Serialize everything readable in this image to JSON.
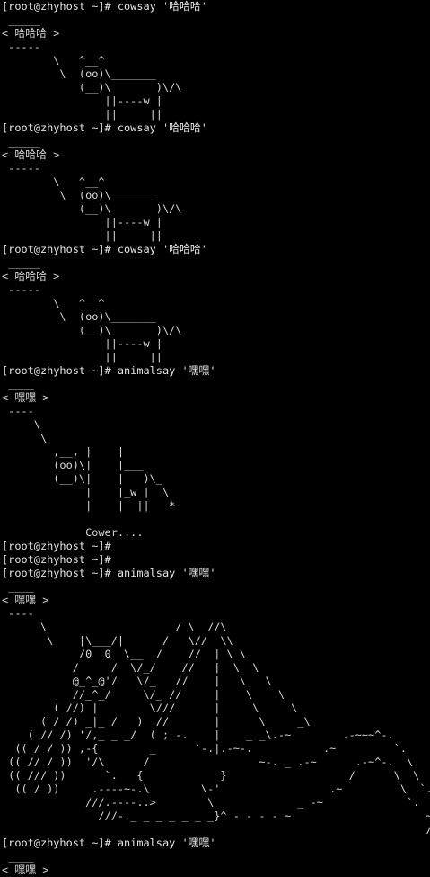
{
  "terminal": {
    "lines": [
      "[root@zhyhost ~]# cowsay '哈哈哈'",
      " _____",
      "< 哈哈哈 >",
      " -----",
      "        \\   ^__^",
      "         \\  (oo)\\_______",
      "            (__)\\       )\\/\\",
      "                ||----w |",
      "                ||     ||",
      "[root@zhyhost ~]# cowsay '哈哈哈'",
      " _____",
      "< 哈哈哈 >",
      " -----",
      "        \\   ^__^",
      "         \\  (oo)\\_______",
      "            (__)\\       )\\/\\",
      "                ||----w |",
      "                ||     ||",
      "[root@zhyhost ~]# cowsay '哈哈哈'",
      " _____",
      "< 哈哈哈 >",
      " -----",
      "        \\   ^__^",
      "         \\  (oo)\\_______",
      "            (__)\\       )\\/\\",
      "                ||----w |",
      "                ||     ||",
      "[root@zhyhost ~]# animalsay '嘿嘿'",
      " ____",
      "< 嘿嘿 >",
      " ----",
      "     \\",
      "      \\",
      "        ,__, |    |",
      "        (oo)\\|    |___",
      "        (__)\\|    |   )\\_",
      "             |    |_w |  \\",
      "             |    |  ||   *",
      "",
      "             Cower....",
      "[root@zhyhost ~]#",
      "[root@zhyhost ~]#",
      "[root@zhyhost ~]# animalsay '嘿嘿'",
      " ____",
      "< 嘿嘿 >",
      " ----",
      "      \\                    / \\  //\\",
      "       \\    |\\___/|      /   \\//  \\\\",
      "            /0  0  \\__  /    //  | \\ \\",
      "           /     /  \\/_/    //   |  \\  \\",
      "           @_^_@'/   \\/_   //    |   \\   \\",
      "           //_^_/     \\/_ //     |    \\    \\",
      "        ( //) |        \\///      |     \\     \\",
      "      ( / /) _|_ /   )  //       |      \\     _\\",
      "    ( // /) '/,_ _ _/  ( ; -.    |    _ _\\.-~        .-~~~^-.",
      "  (( / / )) ,-{        _      `-.|.-~-.           .~         `.",
      " (( // / ))  '/\\      /                 ~-. _ .-~      .-~^-.  \\",
      " (( /// ))      `.   {            }                   /      \\  \\",
      "  (( / ))     .----~-.\\        \\-'                 .~         \\  `. \\^-.",
      "             ///.----..>        \\             _ -~             `.  ^-`  ^-_",
      "               ///-._ _ _ _ _ _ _}^ - - - - ~                     ~-- ,.-~",
      "                                                                  /.-~",
      "[root@zhyhost ~]# animalsay '嘿嘿'",
      " ____",
      "< 嘿嘿 >"
    ]
  }
}
